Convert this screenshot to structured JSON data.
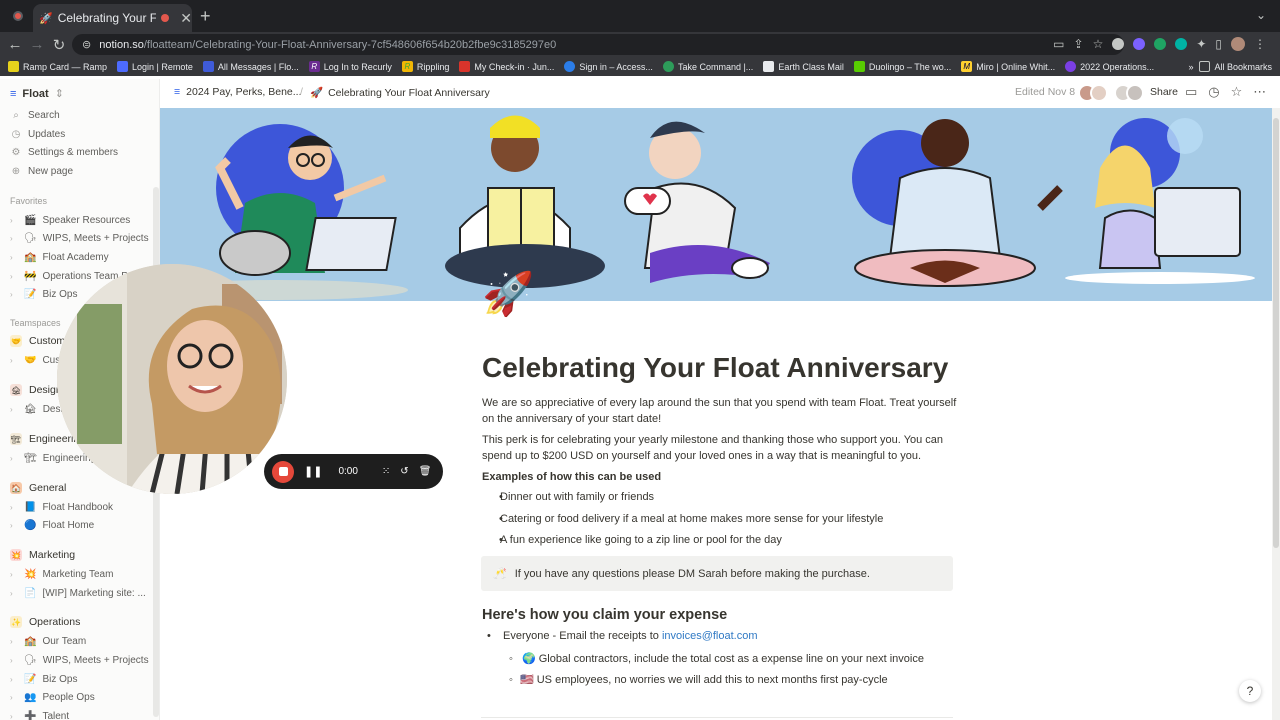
{
  "browser": {
    "tab_title": "Celebrating Your Float Anniversary",
    "url_host": "notion.so",
    "url_path": "/floatteam/Celebrating-Your-Float-Anniversary-7cf548606f654b20b2fbe9c3185297e0",
    "bookmarks": [
      "Ramp Card — Ramp",
      "Login | Remote",
      "All Messages | Flo...",
      "Log In to Recurly",
      "Rippling",
      "My Check-in · Jun...",
      "Sign in – Access...",
      "Take Command |...",
      "Earth Class Mail",
      "Duolingo – The wo...",
      "Miro | Online Whit...",
      "2022 Operations..."
    ],
    "all_bookmarks": "All Bookmarks"
  },
  "sidebar": {
    "workspace": "Float",
    "top_items": [
      "Search",
      "Updates",
      "Settings & members",
      "New page"
    ],
    "favorites_label": "Favorites",
    "favorites": [
      "Speaker Resources",
      "WIPS, Meets + Projects",
      "Float Academy",
      "Operations Team Pr...",
      "Biz Ops"
    ],
    "teamspaces_label": "Teamspaces",
    "teams": [
      {
        "name": "Custom...",
        "sub": "Custo..."
      },
      {
        "name": "Design",
        "sub": "Desig..."
      },
      {
        "name": "Engineering",
        "sub": "Engineering"
      },
      {
        "name": "General",
        "sub": "Float Handbook",
        "sub2": "Float Home"
      },
      {
        "name": "Marketing",
        "sub": "Marketing Team",
        "sub2": "[WIP] Marketing site: ..."
      },
      {
        "name": "Operations",
        "sub": "Our Team",
        "sub2": "WIPS, Meets + Projects",
        "sub3": "Biz Ops",
        "sub4": "People Ops",
        "sub5": "Talent"
      }
    ]
  },
  "topbar": {
    "breadcrumb_parent": "2024 Pay, Perks, Bene...",
    "breadcrumb_current": "Celebrating Your Float Anniversary",
    "edited": "Edited Nov 8",
    "share": "Share"
  },
  "page": {
    "title": "Celebrating Your Float Anniversary",
    "p1": "We are so appreciative of every lap around the sun that you spend with team Float. Treat yourself on the anniversary of your start date!",
    "p2": "This perk is for celebrating your yearly milestone and thanking those who support you. You can spend up to $200 USD on yourself and your loved ones in a way that is meaningful to you.",
    "examples_heading": "Examples of how this can be used",
    "examples": [
      "Dinner out with family or friends",
      "Catering or food delivery if a meal at home makes more sense for your lifestyle",
      "A fun experience like going to a zip line or pool for the day"
    ],
    "callout": "If you have any questions please DM Sarah before making the purchase.",
    "claim_heading": "Here's how you claim your expense",
    "claim_intro": "Everyone - Email the receipts to",
    "claim_email": "invoices@float.com",
    "claim_sub1": "Global contractors, include the total cost as a expense line on your next invoice",
    "claim_sub2": "US employees, no worries we will add this to next months first pay-cycle"
  },
  "recorder": {
    "time": "0:00"
  },
  "help": "?"
}
